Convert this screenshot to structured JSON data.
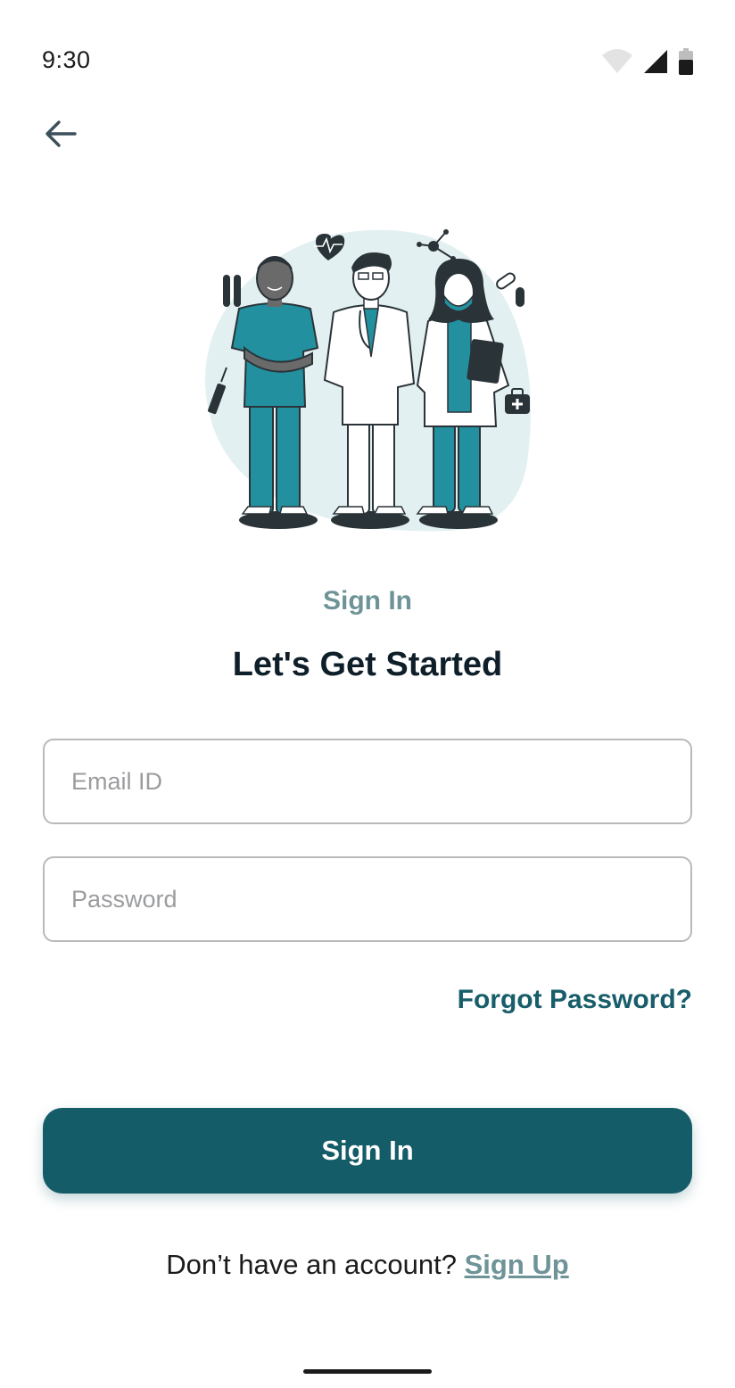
{
  "status_bar": {
    "time": "9:30",
    "icons": [
      "wifi-icon",
      "cellular-signal-icon",
      "battery-icon"
    ]
  },
  "nav": {
    "back_icon": "arrow-left-icon"
  },
  "illustration": {
    "subject": "medical-team-illustration"
  },
  "header": {
    "eyebrow": "Sign In",
    "title": "Let's Get Started"
  },
  "form": {
    "email": {
      "placeholder": "Email ID",
      "value": ""
    },
    "password": {
      "placeholder": "Password",
      "value": ""
    },
    "forgot_label": "Forgot Password?",
    "submit_label": "Sign In"
  },
  "footer": {
    "prompt": "Don’t have an account?",
    "signup_label": "Sign Up"
  },
  "colors": {
    "primary": "#155c69",
    "accent_text": "#6e9498",
    "link": "#175d6a",
    "teal_scrubs": "#22909f",
    "blob": "#e3f0f2"
  }
}
